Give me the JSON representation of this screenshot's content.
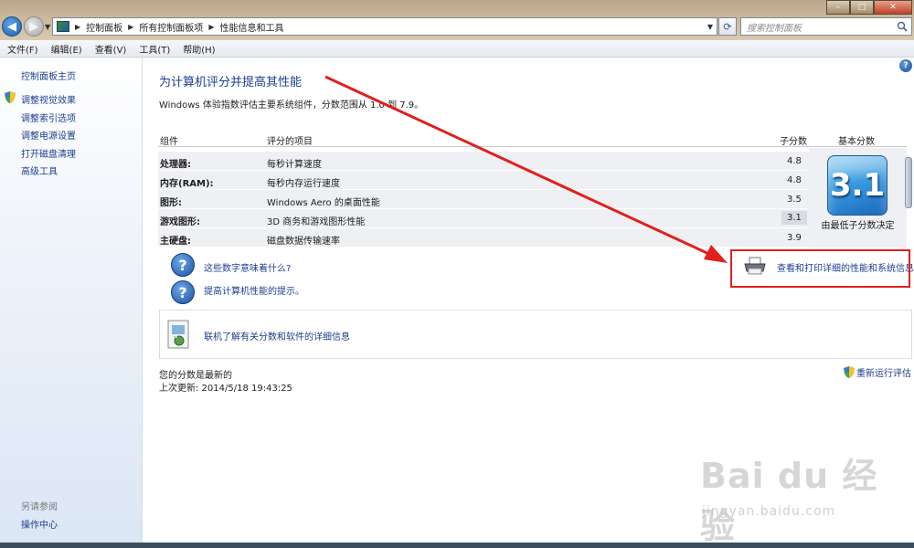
{
  "window": {
    "breadcrumbs": [
      "控制面板",
      "所有控制面板项",
      "性能信息和工具"
    ],
    "search_placeholder": "搜索控制面板",
    "controls": {
      "minimize": "–",
      "maximize": "□",
      "close": "✕"
    }
  },
  "menu": [
    "文件(F)",
    "编辑(E)",
    "查看(V)",
    "工具(T)",
    "帮助(H)"
  ],
  "sidebar": {
    "home": "控制面板主页",
    "links": [
      {
        "label": "调整视觉效果",
        "shield": true
      },
      {
        "label": "调整索引选项",
        "shield": false
      },
      {
        "label": "调整电源设置",
        "shield": false
      },
      {
        "label": "打开磁盘清理",
        "shield": false
      },
      {
        "label": "高级工具",
        "shield": false
      }
    ],
    "see_also": "另请参阅",
    "action_center": "操作中心"
  },
  "main": {
    "title": "为计算机评分并提高其性能",
    "description": "Windows 体验指数评估主要系统组件，分数范围从 1.0 到 7.9。",
    "table": {
      "headers": {
        "component": "组件",
        "rated": "评分的项目",
        "subscore": "子分数",
        "basescore": "基本分数"
      },
      "rows": [
        {
          "component": "处理器:",
          "rated": "每秒计算速度",
          "subscore": "4.8"
        },
        {
          "component": "内存(RAM):",
          "rated": "每秒内存运行速度",
          "subscore": "4.8"
        },
        {
          "component": "图形:",
          "rated": "Windows Aero 的桌面性能",
          "subscore": "3.5"
        },
        {
          "component": "游戏图形:",
          "rated": "3D 商务和游戏图形性能",
          "subscore": "3.1"
        },
        {
          "component": "主硬盘:",
          "rated": "磁盘数据传输速率",
          "subscore": "3.9"
        }
      ],
      "base_score": "3.1",
      "base_caption": "由最低子分数决定"
    },
    "links": {
      "what_mean": "这些数字意味着什么?",
      "tips": "提高计算机性能的提示。",
      "print_details": "查看和打印详细的性能和系统信息",
      "online_info": "联机了解有关分数和软件的详细信息",
      "rerun": "重新运行评估"
    },
    "status": "您的分数是最新的",
    "last_update": "上次更新: 2014/5/18 19:43:25"
  },
  "watermark": {
    "logo": "Bai du 经验",
    "url": "jingyan.baidu.com"
  },
  "colors": {
    "link": "#1c3f8e",
    "title": "#1e3d8f",
    "annotation": "#e0201c",
    "badge": "#3a9be0"
  }
}
